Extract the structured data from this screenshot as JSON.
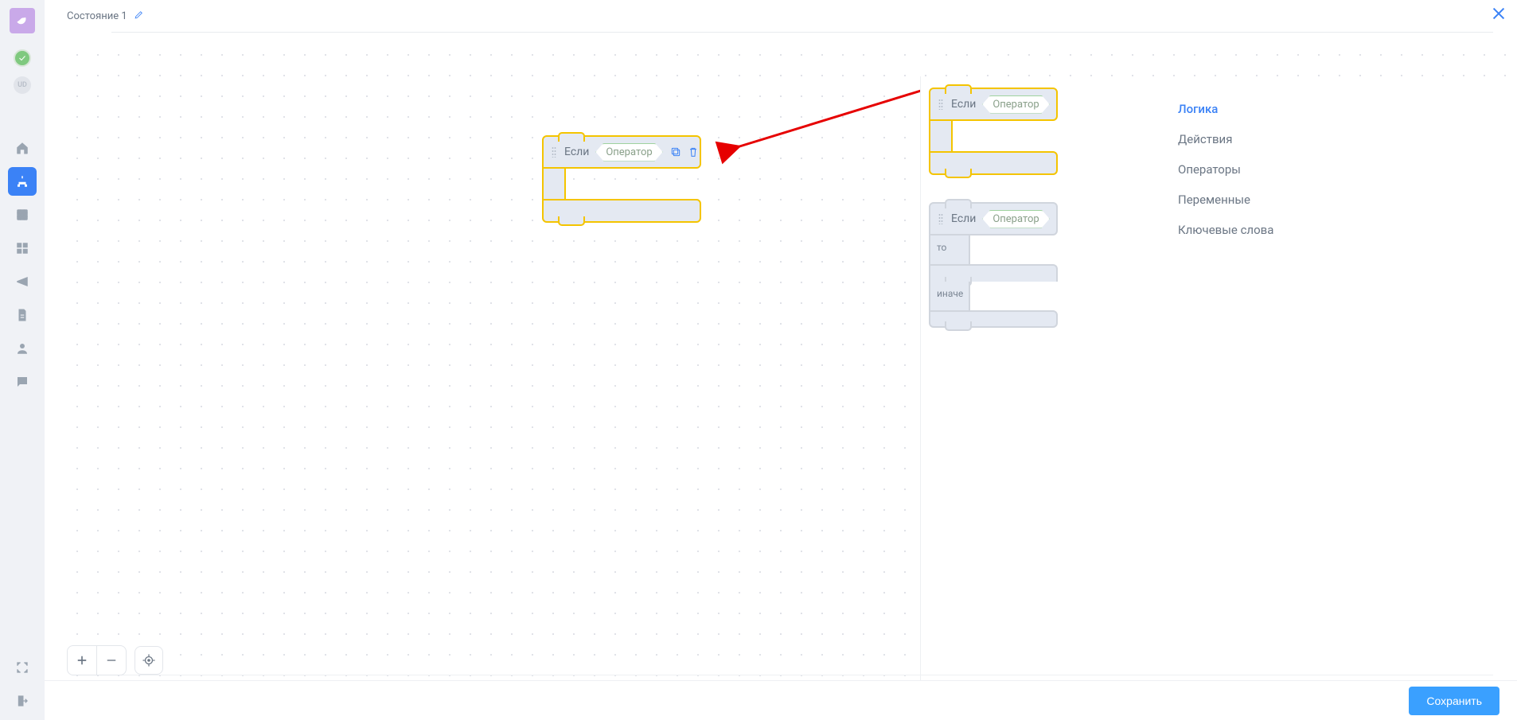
{
  "header": {
    "state_title": "Состояние 1"
  },
  "ud_badge": "UD",
  "canvas_block": {
    "if_label": "Если",
    "operator": "Оператор"
  },
  "palette_blocks": {
    "if": {
      "if_label": "Если",
      "operator": "Оператор"
    },
    "ifelse": {
      "if_label": "Если",
      "operator": "Оператор",
      "then": "то",
      "else": "иначе"
    }
  },
  "categories": [
    "Логика",
    "Действия",
    "Операторы",
    "Переменные",
    "Ключевые слова"
  ],
  "active_category_index": 0,
  "footer": {
    "save_label": "Сохранить"
  }
}
